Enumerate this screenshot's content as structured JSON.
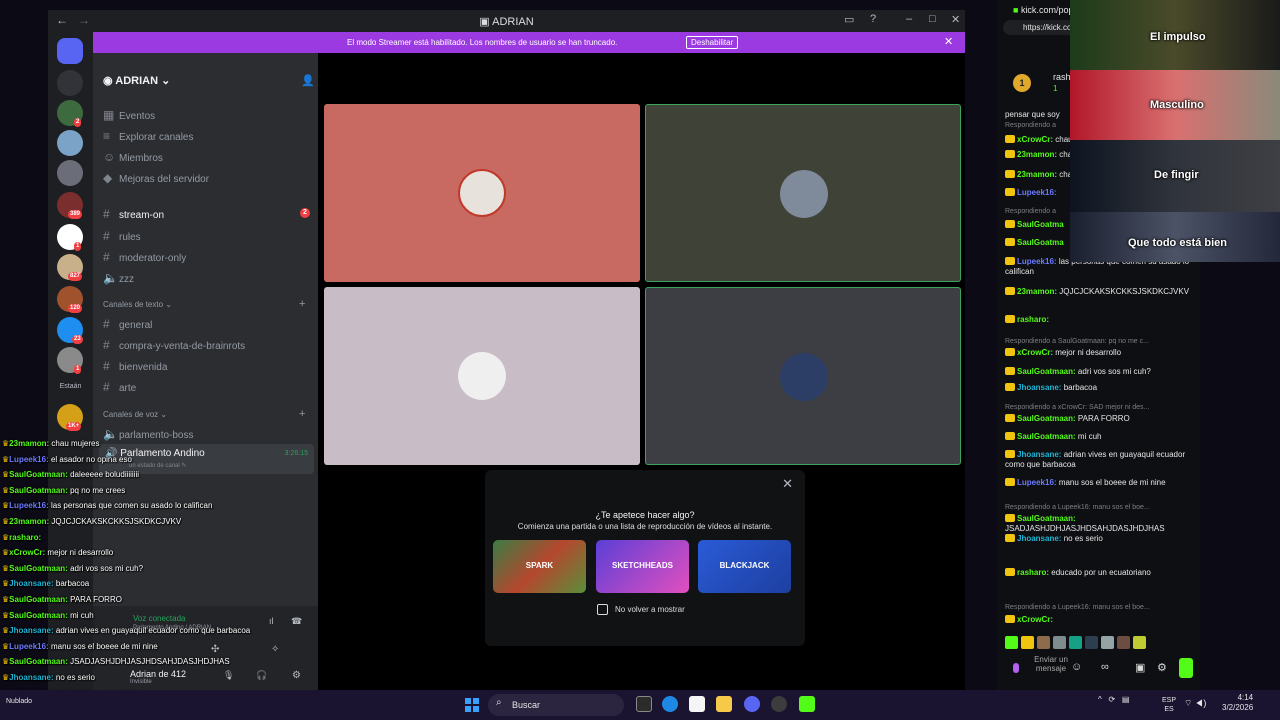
{
  "discord": {
    "title": "ADRIAN",
    "banner_text": "El modo Streamer está habilitado. Los nombres de usuario se han truncado.",
    "banner_button": "Deshabilitar",
    "server_name": "ADRIAN",
    "guild_label": "Estaán",
    "guild_badges": [
      "2",
      "389",
      "1",
      "827",
      "120",
      "23",
      "1",
      "1K+"
    ],
    "nav_items": [
      "Eventos",
      "Explorar canales",
      "Miembros",
      "Mejoras del servidor"
    ],
    "channels_top": [
      {
        "name": "stream-on",
        "unread": "2"
      },
      {
        "name": "rules"
      },
      {
        "name": "moderator-only"
      },
      {
        "name": "zzz"
      }
    ],
    "text_category": "Canales de texto",
    "text_channels": [
      "general",
      "compra-y-venta-de-brainrots",
      "bienvenida",
      "arte"
    ],
    "voice_category": "Canales de voz",
    "voice_channels": [
      "parlamento-boss",
      "Parlamento Andino"
    ],
    "voice_timer": "3:26:15",
    "voice_status_placeholder": "un estado de canal",
    "voice_connected": "Voz conectada",
    "voice_location": "Parlamento Andino / ADRIAN",
    "user_name": "Adrian de 412",
    "user_status": "Invisible",
    "promo": {
      "question": "¿Te apetece hacer algo?",
      "subtitle": "Comienza una partida o una lista de reproducción de vídeos al instante.",
      "activities": [
        "SPARK",
        "SKETCHHEADS",
        "BLACKJACK"
      ],
      "checkbox_label": "No volver a mostrar"
    },
    "tile_colors": [
      "#c96a62",
      "#3f4237",
      "#c8bcc6",
      "#3c3e44"
    ]
  },
  "browser": {
    "tab_title": "kick.com/popo",
    "url": "https://kick.co",
    "streamer_name": "rashan",
    "streamer_sub": "1"
  },
  "overlay_captions": [
    "El impulso",
    "Masculino",
    "De fingir",
    "Que todo está bien"
  ],
  "kick_chat": [
    {
      "reply": "",
      "user": "",
      "text": "pensar que soy",
      "color": "#e6e6e6"
    },
    {
      "reply": "Respondiendo a",
      "user": "",
      "text": "",
      "color": "#e6e6e6"
    },
    {
      "reply": "",
      "user": "xCrowCr:",
      "text": "chau",
      "color": "#53fc18"
    },
    {
      "reply": "",
      "user": "23mamon:",
      "text": "chau",
      "color": "#53fc18"
    },
    {
      "reply": "",
      "user": "23mamon:",
      "text": "chau",
      "color": "#53fc18"
    },
    {
      "reply": "",
      "user": "Lupeek16:",
      "text": "",
      "color": "#6a7bff"
    },
    {
      "reply": "Respondiendo a",
      "user": "",
      "text": "",
      "color": "#e6e6e6"
    },
    {
      "reply": "",
      "user": "SaulGoatma",
      "text": "",
      "color": "#53fc18"
    },
    {
      "reply": "",
      "user": "SaulGoatma",
      "text": "",
      "color": "#53fc18"
    },
    {
      "reply": "",
      "user": "Lupeek16:",
      "text": "las personas que comen su asado lo califican",
      "color": "#6a7bff"
    },
    {
      "reply": "",
      "user": "23mamon:",
      "text": "JQJCJCKAKSKCKKSJSKDKCJVKV",
      "color": "#53fc18"
    },
    {
      "reply": "",
      "user": "rasharo:",
      "text": "",
      "color": "#53fc18"
    },
    {
      "reply": "Respondiendo a SaulGoatmaan: pq no me c...",
      "user": "",
      "text": "",
      "color": "#e6e6e6"
    },
    {
      "reply": "",
      "user": "xCrowCr:",
      "text": "mejor ni desarrollo",
      "color": "#53fc18"
    },
    {
      "reply": "",
      "user": "SaulGoatmaan:",
      "text": "adri vos sos mi cuh?",
      "color": "#53fc18"
    },
    {
      "reply": "",
      "user": "Jhoansane:",
      "text": "barbacoa",
      "color": "#1fb5d6"
    },
    {
      "reply": "Respondiendo a xCrowCr: SAD mejor ni des...",
      "user": "",
      "text": "",
      "color": "#e6e6e6"
    },
    {
      "reply": "",
      "user": "SaulGoatmaan:",
      "text": "PARA FORRO",
      "color": "#53fc18"
    },
    {
      "reply": "",
      "user": "SaulGoatmaan:",
      "text": "mi cuh",
      "color": "#53fc18"
    },
    {
      "reply": "",
      "user": "Jhoansane:",
      "text": "adrian vives en guayaquil ecuador como que barbacoa",
      "color": "#1fb5d6"
    },
    {
      "reply": "",
      "user": "Lupeek16:",
      "text": "manu sos el boeee de mi nine",
      "color": "#6a7bff"
    },
    {
      "reply": "Respondiendo a Lupeek16: manu sos el boe...",
      "user": "",
      "text": "",
      "color": "#e6e6e6"
    },
    {
      "reply": "",
      "user": "SaulGoatmaan:",
      "text": "JSADJASHJDHJASJHDSAHJDASJHDJHAS",
      "color": "#53fc18"
    },
    {
      "reply": "",
      "user": "Jhoansane:",
      "text": "no es serio",
      "color": "#1fb5d6"
    },
    {
      "reply": "",
      "user": "rasharo:",
      "text": "educado por un ecuatoriano",
      "color": "#53fc18"
    },
    {
      "reply": "Respondiendo a Lupeek16: manu sos el boe...",
      "user": "",
      "text": "",
      "color": "#e6e6e6"
    },
    {
      "reply": "",
      "user": "xCrowCr:",
      "text": "",
      "color": "#53fc18"
    }
  ],
  "kick_input": {
    "placeholder": "Enviar un mensaje"
  },
  "overlay_chat": [
    {
      "user": "23mamon:",
      "text": "chau mujeres",
      "color": "#53fc18"
    },
    {
      "user": "Lupeek16:",
      "text": "el asador no opina eso",
      "color": "#6a7bff"
    },
    {
      "user": "SaulGoatmaan:",
      "text": "daleeeee boludiiiiiiii",
      "color": "#53fc18"
    },
    {
      "user": "SaulGoatmaan:",
      "text": "pq no me crees",
      "color": "#53fc18"
    },
    {
      "user": "Lupeek16:",
      "text": "las personas que comen su asado lo califican",
      "color": "#6a7bff"
    },
    {
      "user": "23mamon:",
      "text": "JQJCJCKAKSKCKKSJSKDKCJVKV",
      "color": "#53fc18"
    },
    {
      "user": "rasharo:",
      "text": "",
      "color": "#53fc18"
    },
    {
      "user": "xCrowCr:",
      "text": "mejor ni desarrollo",
      "color": "#53fc18"
    },
    {
      "user": "SaulGoatmaan:",
      "text": "adri vos sos mi cuh?",
      "color": "#53fc18"
    },
    {
      "user": "Jhoansane:",
      "text": "barbacoa",
      "color": "#1fb5d6"
    },
    {
      "user": "SaulGoatmaan:",
      "text": "PARA FORRO",
      "color": "#53fc18"
    },
    {
      "user": "SaulGoatmaan:",
      "text": "mi cuh",
      "color": "#53fc18"
    },
    {
      "user": "Jhoansane:",
      "text": "adrian vives en guayaquil ecuador como que barbacoa",
      "color": "#1fb5d6"
    },
    {
      "user": "Lupeek16:",
      "text": "manu sos el boeee de mi nine",
      "color": "#6a7bff"
    },
    {
      "user": "SaulGoatmaan:",
      "text": "JSADJASHJDHJASJHDSAHJDASJHDJHAS",
      "color": "#53fc18"
    },
    {
      "user": "Jhoansane:",
      "text": "no es serio",
      "color": "#1fb5d6"
    },
    {
      "user": "rasharo:",
      "text": "educado por un ecuatoriano",
      "color": "#53fc18"
    }
  ],
  "taskbar": {
    "search_label": "Buscar",
    "weather": "Nublado",
    "lang_top": "ESP",
    "lang_bottom": "ES",
    "time": "4:14",
    "date": "3/2/2026"
  }
}
